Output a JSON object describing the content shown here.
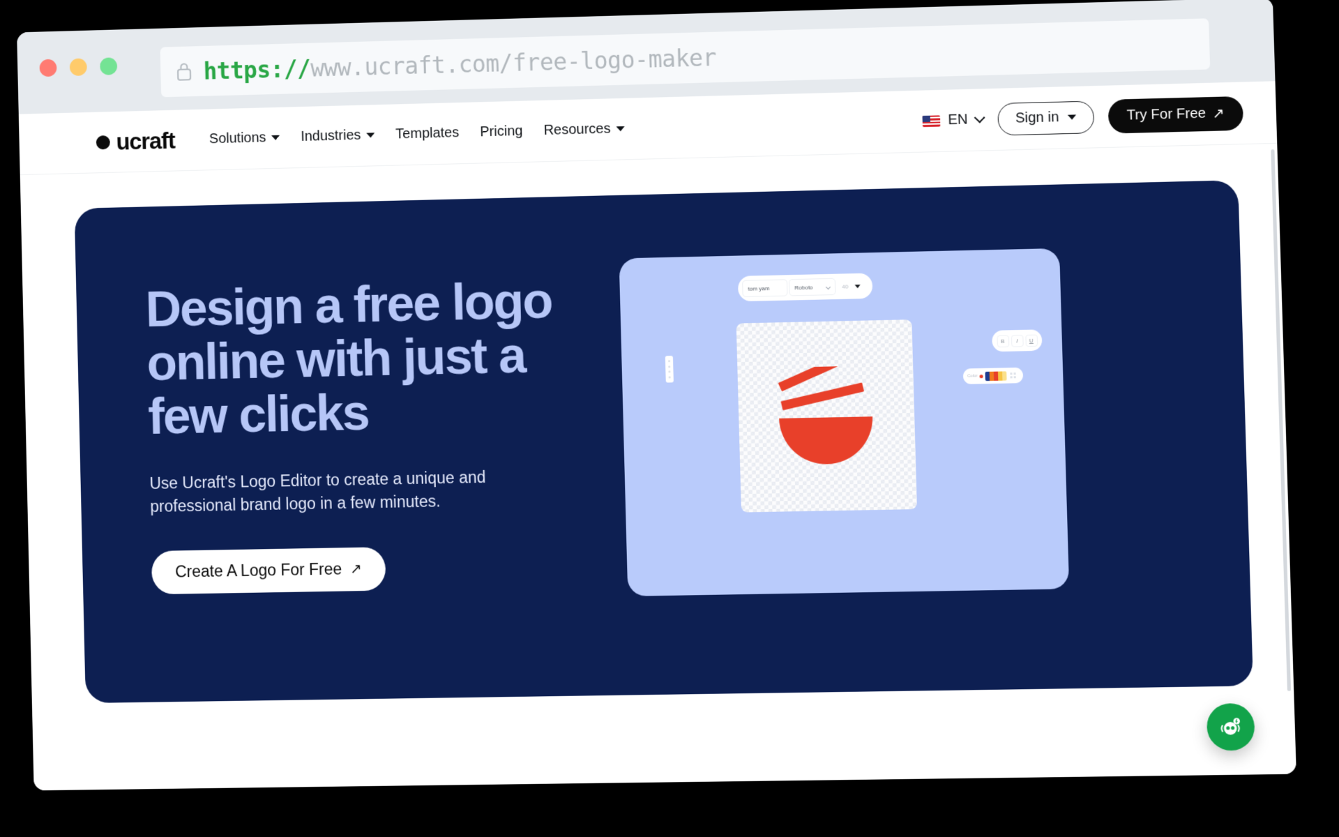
{
  "browser": {
    "window_controls": [
      "close",
      "minimize",
      "maximize"
    ],
    "url_scheme": "https://",
    "url_rest": "www.ucraft.com/free-logo-maker",
    "lock_icon": "lock-icon",
    "colors": {
      "chrome_bg": "#e6eaee",
      "url_bg": "#f7f9fb",
      "scheme_green": "#2aa746",
      "url_gray": "#b2b8bd",
      "dot_red": "#ff7b72",
      "dot_yellow": "#ffcb6b",
      "dot_green": "#74e394"
    }
  },
  "header": {
    "logo_text": "ucraft",
    "nav": [
      {
        "label": "Solutions",
        "has_caret": true
      },
      {
        "label": "Industries",
        "has_caret": true
      },
      {
        "label": "Templates",
        "has_caret": false
      },
      {
        "label": "Pricing",
        "has_caret": false
      },
      {
        "label": "Resources",
        "has_caret": true
      }
    ],
    "language": {
      "code": "EN",
      "flag": "us-flag-icon"
    },
    "signin_label": "Sign in",
    "try_free_label": "Try For Free",
    "try_free_arrow": "↗"
  },
  "hero": {
    "title": "Design a free logo online with just a few clicks",
    "subtitle": "Use Ucraft's Logo Editor to create a unique and professional brand logo in a few minutes.",
    "cta_label": "Create A Logo For Free",
    "cta_arrow": "↗",
    "colors": {
      "card_bg": "#0d1f52",
      "title": "#b6c6f7",
      "subtitle": "#e4e9fb",
      "cta_bg": "#ffffff",
      "cta_text": "#0b0b0b"
    }
  },
  "editor_mock": {
    "panel_bg": "#b9cbfb",
    "toolbar": {
      "layer_name": "tom yam",
      "font_family": "Roboto",
      "font_size": "40"
    },
    "format_keys": [
      "B",
      "I",
      "U"
    ],
    "color_bar": {
      "label": "Color",
      "swatches": [
        "#1d3a8f",
        "#f07a1e",
        "#e8402a",
        "#f6c445",
        "#fbe08a"
      ]
    },
    "artwork": {
      "name": "ramen-bowl-logo",
      "color": "#e8402a",
      "parts": [
        "bowl",
        "chopstick-upper",
        "chopstick-lower"
      ]
    }
  },
  "chat": {
    "label": "chat-bot-widget",
    "color": "#12a34a"
  }
}
